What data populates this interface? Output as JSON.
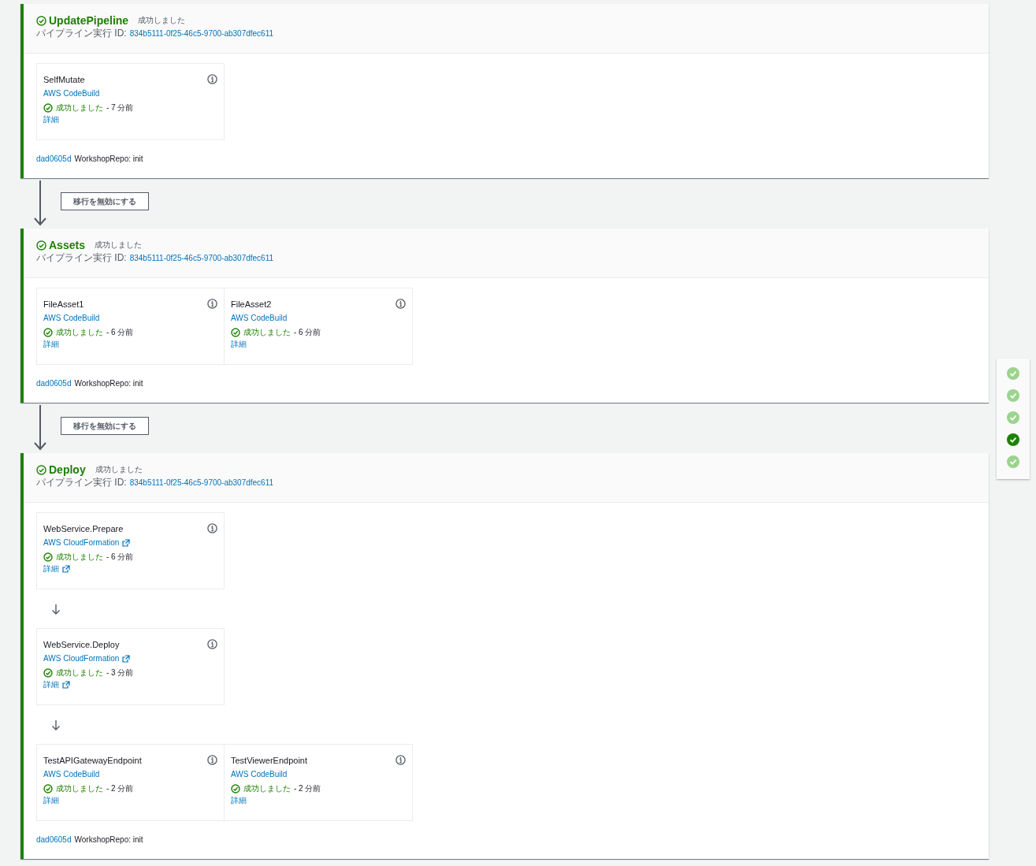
{
  "stages": [
    {
      "name": "UpdatePipeline",
      "status": "成功しました",
      "execution_label": "パイプライン実行 ID:",
      "execution_id": "834b5111-0f25-46c5-9700-ab307dfec611",
      "action_rows": [
        [
          {
            "name": "SelfMutate",
            "provider": "AWS CodeBuild",
            "provider_external": false,
            "status": "成功しました",
            "time": "- 7 分前",
            "details": "詳細",
            "details_external": false
          }
        ]
      ],
      "commit": {
        "id": "dad0605d",
        "message": "WorkshopRepo: init"
      },
      "transition": "移行を無効にする"
    },
    {
      "name": "Assets",
      "status": "成功しました",
      "execution_label": "パイプライン実行 ID:",
      "execution_id": "834b5111-0f25-46c5-9700-ab307dfec611",
      "action_rows": [
        [
          {
            "name": "FileAsset1",
            "provider": "AWS CodeBuild",
            "provider_external": false,
            "status": "成功しました",
            "time": "- 6 分前",
            "details": "詳細",
            "details_external": false
          },
          {
            "name": "FileAsset2",
            "provider": "AWS CodeBuild",
            "provider_external": false,
            "status": "成功しました",
            "time": "- 6 分前",
            "details": "詳細",
            "details_external": false
          }
        ]
      ],
      "commit": {
        "id": "dad0605d",
        "message": "WorkshopRepo: init"
      },
      "transition": "移行を無効にする"
    },
    {
      "name": "Deploy",
      "status": "成功しました",
      "execution_label": "パイプライン実行 ID:",
      "execution_id": "834b5111-0f25-46c5-9700-ab307dfec611",
      "action_rows": [
        [
          {
            "name": "WebService.Prepare",
            "provider": "AWS CloudFormation",
            "provider_external": true,
            "status": "成功しました",
            "time": "- 6 分前",
            "details": "詳細",
            "details_external": true
          }
        ],
        [
          {
            "name": "WebService.Deploy",
            "provider": "AWS CloudFormation",
            "provider_external": true,
            "status": "成功しました",
            "time": "- 3 分前",
            "details": "詳細",
            "details_external": true
          }
        ],
        [
          {
            "name": "TestAPIGatewayEndpoint",
            "provider": "AWS CodeBuild",
            "provider_external": false,
            "status": "成功しました",
            "time": "- 2 分前",
            "details": "詳細",
            "details_external": false
          },
          {
            "name": "TestViewerEndpoint",
            "provider": "AWS CodeBuild",
            "provider_external": false,
            "status": "成功しました",
            "time": "- 2 分前",
            "details": "詳細",
            "details_external": false
          }
        ]
      ],
      "commit": {
        "id": "dad0605d",
        "message": "WorkshopRepo: init"
      }
    }
  ],
  "minimap": [
    {
      "selected": false
    },
    {
      "selected": false
    },
    {
      "selected": false
    },
    {
      "selected": true
    },
    {
      "selected": false
    }
  ]
}
